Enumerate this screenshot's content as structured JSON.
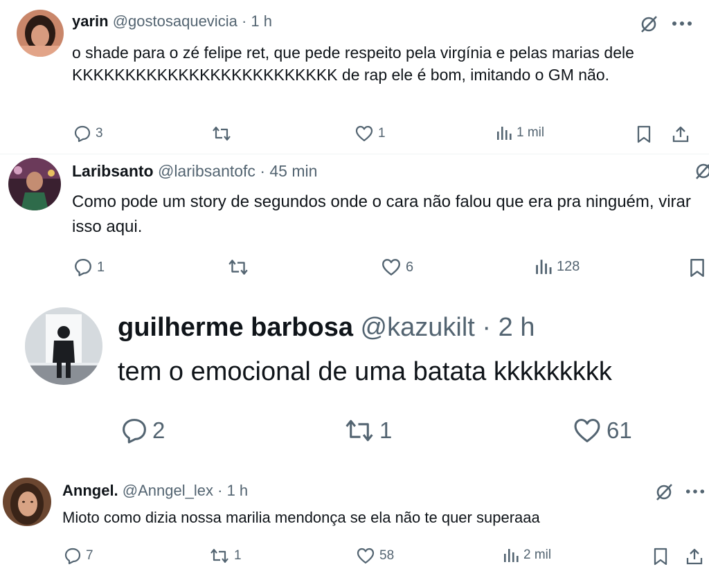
{
  "tweets": [
    {
      "name": "yarin",
      "handle": "@gostosaquevicia",
      "time": "1 h",
      "text": "o shade para o zé felipe ret, que pede respeito pela virgínia e pelas marias dele KKKKKKKKKKKKKKKKKKKKKKKKK de rap ele é bom, imitando o GM não.",
      "replies": "3",
      "retweets": "",
      "likes": "1",
      "views": "1 mil"
    },
    {
      "name": "Laribsanto",
      "handle": "@laribsantofc",
      "time": "45 min",
      "text": "Como pode um story de segundos onde o cara não falou que era pra ninguém, virar isso aqui.",
      "replies": "1",
      "retweets": "",
      "likes": "6",
      "views": "128"
    },
    {
      "name": "guilherme barbosa",
      "handle": "@kazukilt",
      "time": "2 h",
      "text": "tem o emocional de uma batata kkkkkkkkk",
      "replies": "2",
      "retweets": "1",
      "likes": "61"
    },
    {
      "name": "Anngel.",
      "handle": "@Anngel_lex",
      "time": "1 h",
      "text": "Mioto como dizia nossa marilia mendonça se ela não te quer superaaa",
      "replies": "7",
      "retweets": "1",
      "likes": "58",
      "views": "2 mil"
    }
  ],
  "separator": "·",
  "icons": [
    "grok-slash-icon",
    "more-dots-icon",
    "reply-icon",
    "retweet-icon",
    "like-icon",
    "views-icon",
    "bookmark-icon",
    "share-icon"
  ],
  "colors": {
    "text": "#0f1419",
    "secondary": "#536471"
  }
}
